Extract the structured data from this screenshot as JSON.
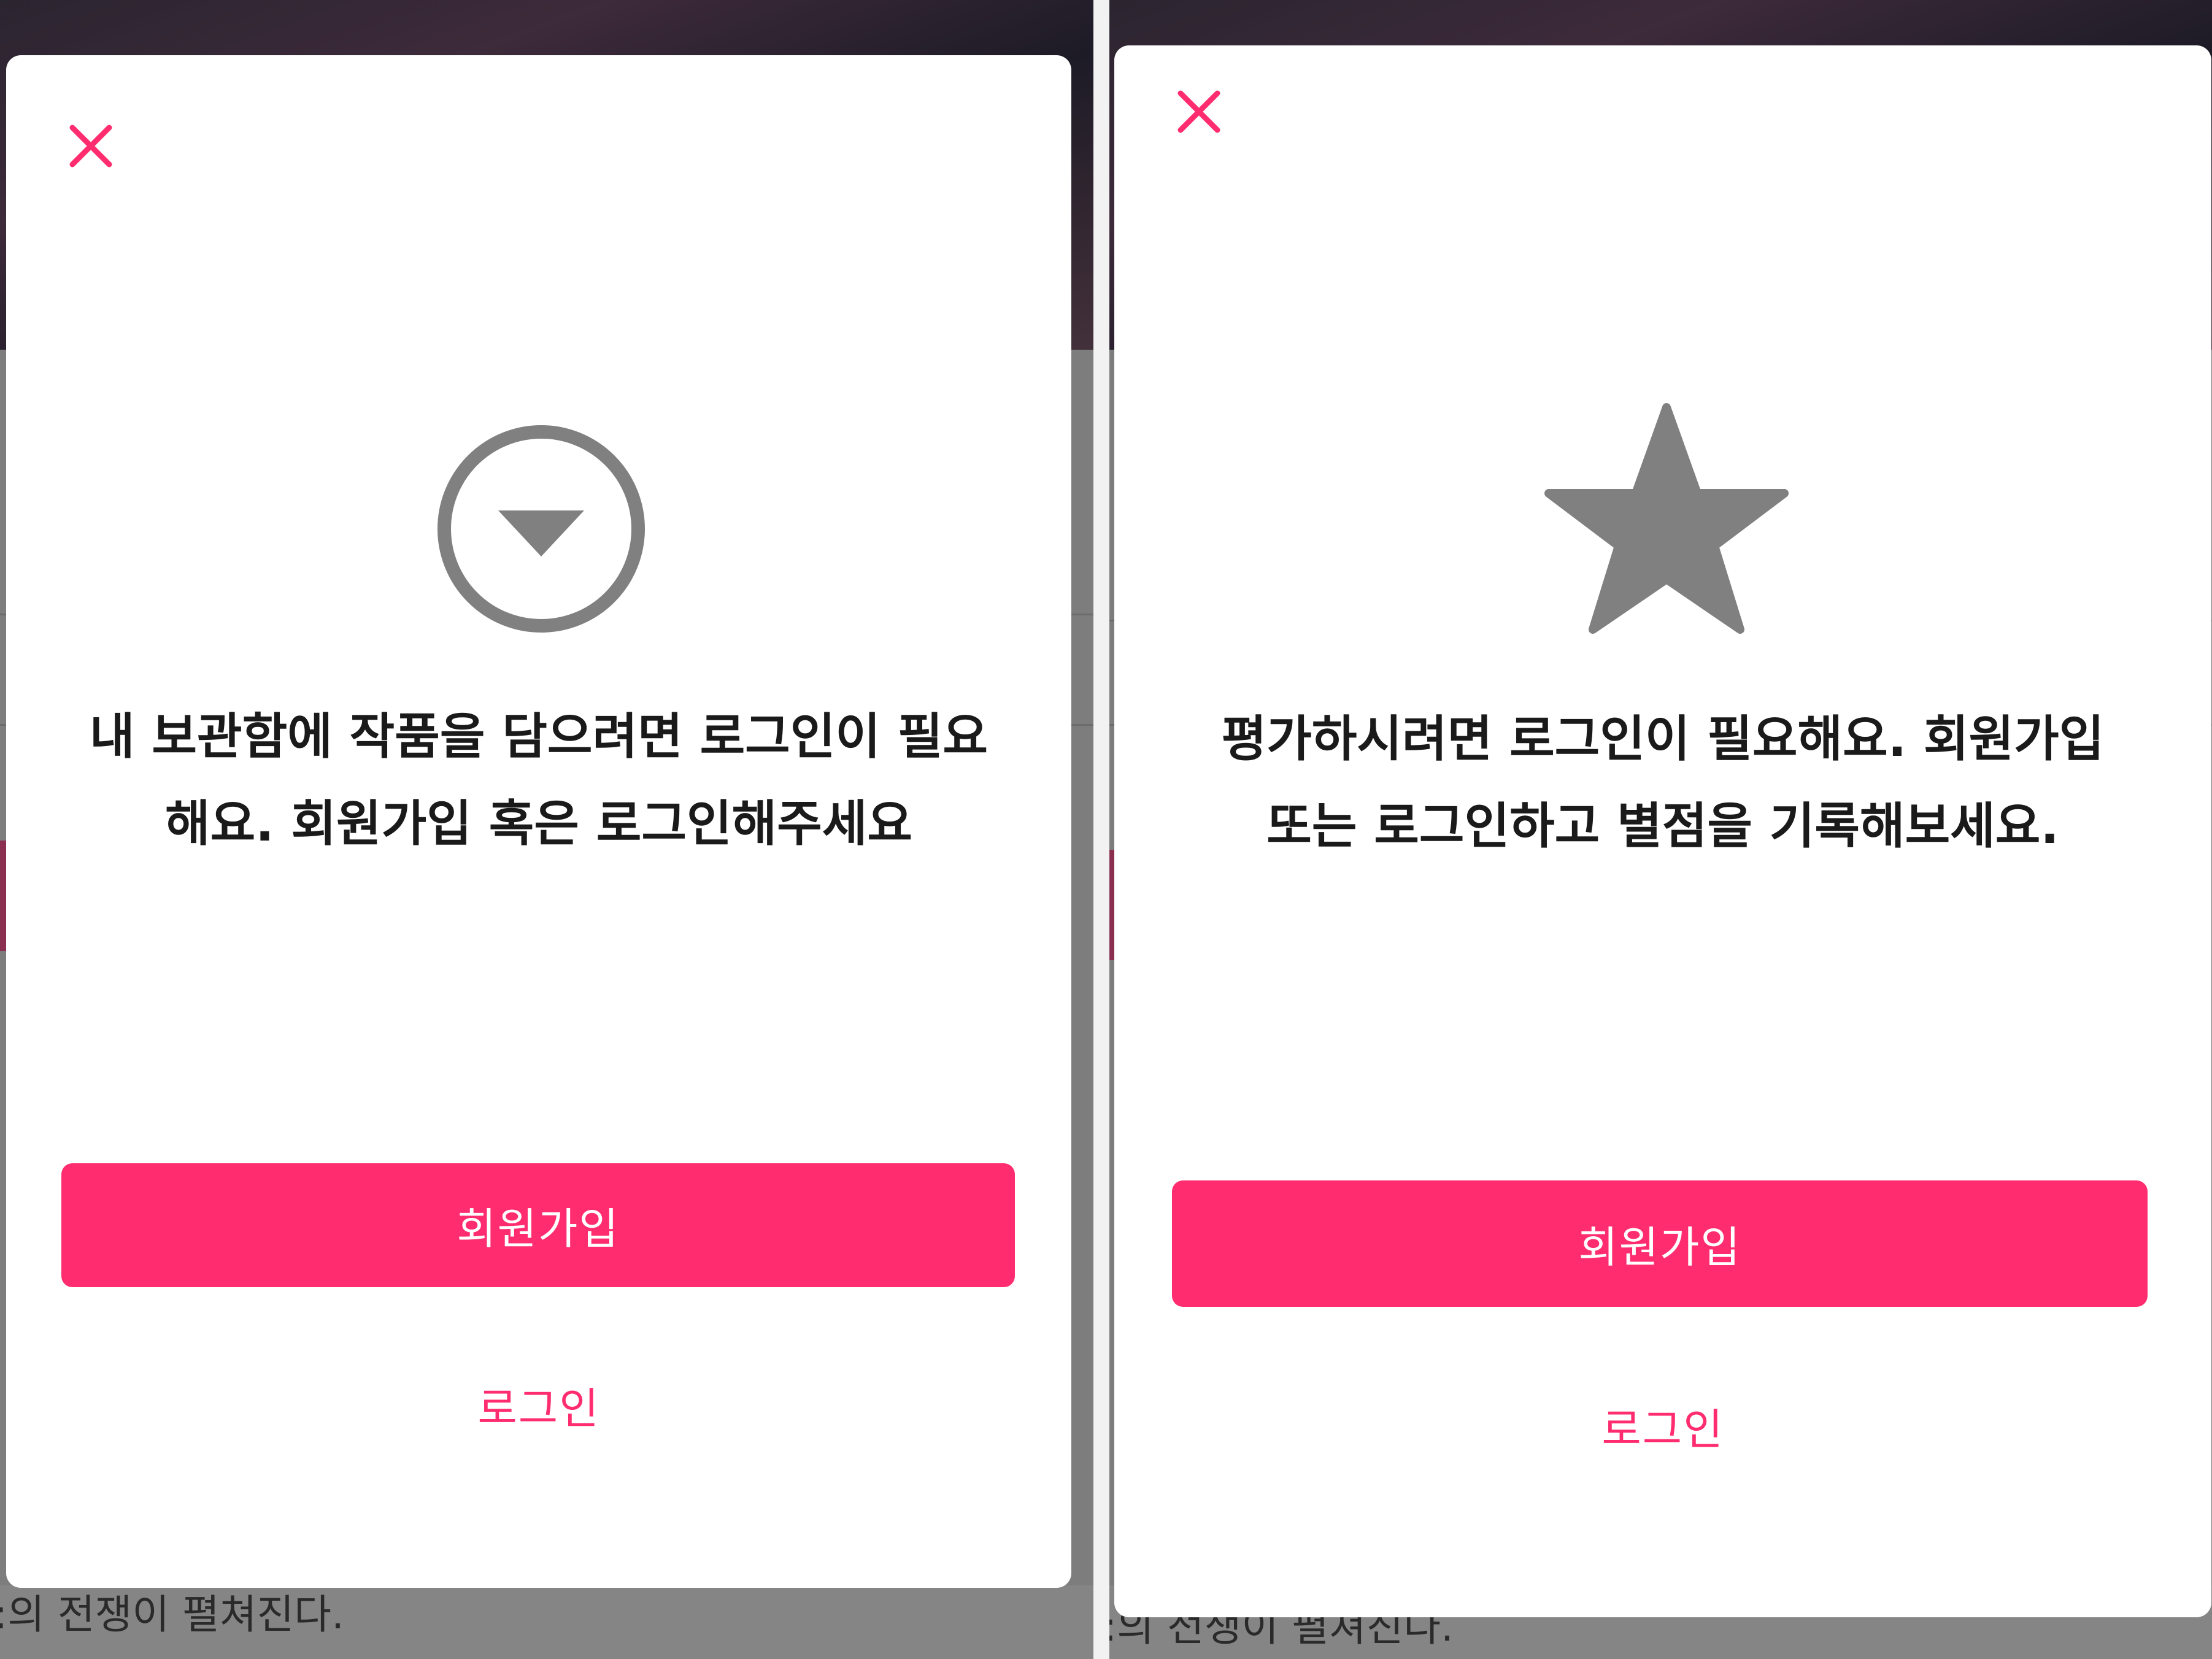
{
  "colors": {
    "accent": "#ff2d6f",
    "icon_gray": "#808080",
    "text_dark": "#1a1a1a",
    "overlay_gray": "#7d7d7d"
  },
  "background_page": {
    "caption_fragment": ":의 전쟁이 펼쳐진다."
  },
  "modals": [
    {
      "close_icon": "close-icon",
      "icon": "circle-arrow-down-icon",
      "message": "내 보관함에 작품을 담으려면 로그인이 필요\n해요. 회원가입 혹은 로그인해주세요",
      "signup_label": "회원가입",
      "login_label": "로그인"
    },
    {
      "close_icon": "close-icon",
      "icon": "star-icon",
      "message": "평가하시려면 로그인이 필요해요. 회원가입\n또는 로그인하고 별점을 기록해보세요.",
      "signup_label": "회원가입",
      "login_label": "로그인"
    }
  ]
}
